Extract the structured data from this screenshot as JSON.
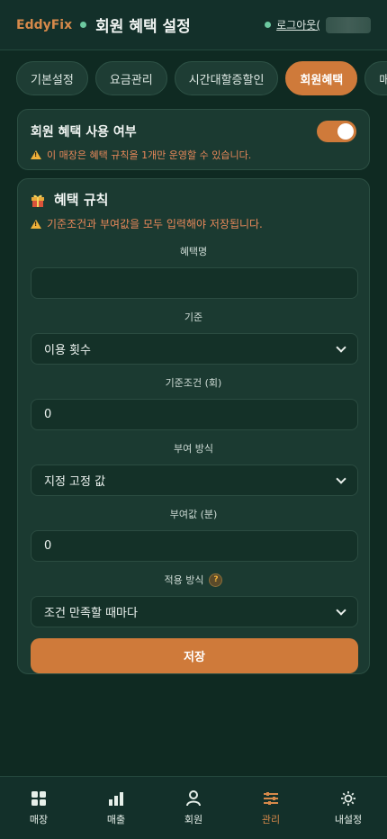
{
  "header": {
    "brand": "EddyFix",
    "title": "회원 혜택 설정",
    "logout": "로그아웃("
  },
  "tabs": [
    "기본설정",
    "요금관리",
    "시간대할증할인",
    "회원혜택",
    "매점"
  ],
  "active_tab": "회원혜택",
  "benefit_toggle": {
    "label": "회원 혜택 사용 여부",
    "enabled": true,
    "warning": "이 매장은 혜택 규칙을 1개만 운영할 수 있습니다."
  },
  "rule": {
    "title": "혜택 규칙",
    "warning": "기준조건과 부여값을 모두 입력해야 저장됩니다.",
    "fields": {
      "name": {
        "label": "혜택명",
        "value": ""
      },
      "basis": {
        "label": "기준",
        "value": "이용 횟수"
      },
      "condition": {
        "label": "기준조건 (회)",
        "value": "0"
      },
      "grant_method": {
        "label": "부여 방식",
        "value": "지정 고정 값"
      },
      "grant_value": {
        "label": "부여값 (분)",
        "value": "0"
      },
      "apply_method": {
        "label": "적용 방식",
        "value": "조건 만족할 때마다",
        "help": "?"
      }
    },
    "save_label": "저장"
  },
  "bottom_nav": [
    {
      "label": "매장",
      "icon": "grid-icon"
    },
    {
      "label": "매출",
      "icon": "bar-chart-icon"
    },
    {
      "label": "회원",
      "icon": "user-icon"
    },
    {
      "label": "관리",
      "icon": "sliders-icon",
      "active": true
    },
    {
      "label": "내설정",
      "icon": "sun-settings-icon"
    }
  ],
  "colors": {
    "accent": "#cf7a3a",
    "background": "#0f2a22",
    "warning": "#e8885a"
  }
}
